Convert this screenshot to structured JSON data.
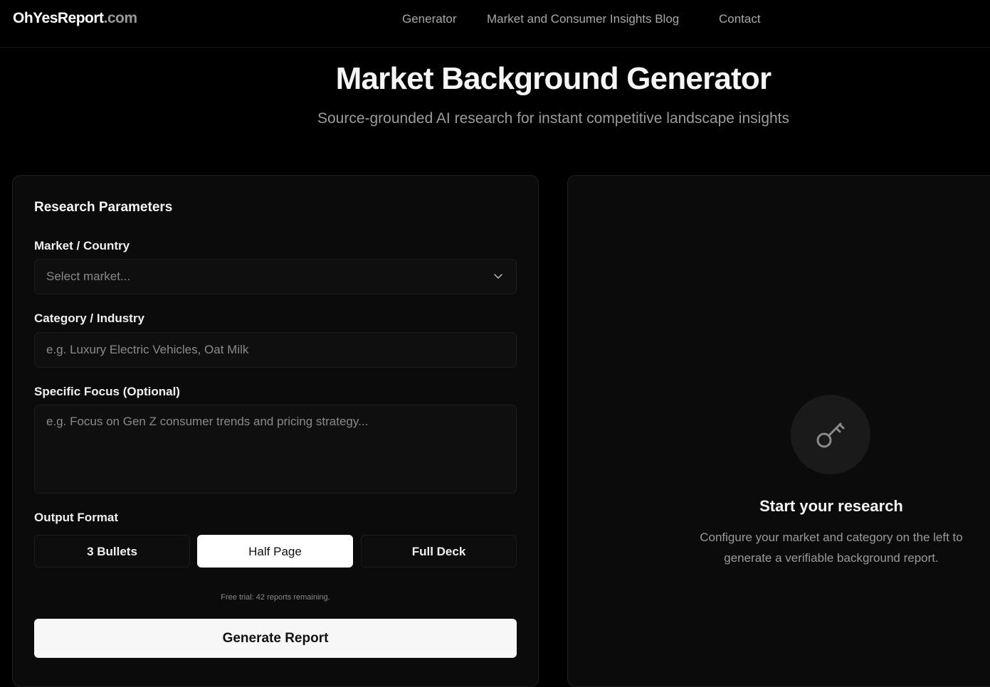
{
  "header": {
    "logo_brand": "OhYesReport",
    "logo_tld": ".com",
    "nav": [
      "Generator",
      "Market and Consumer Insights Blog",
      "Contact"
    ]
  },
  "hero": {
    "title": "Market Background Generator",
    "subtitle": "Source-grounded AI research for instant competitive landscape insights"
  },
  "form": {
    "section_title": "Research Parameters",
    "market_label": "Market / Country",
    "market_placeholder": "Select market...",
    "category_label": "Category / Industry",
    "category_placeholder": "e.g. Luxury Electric Vehicles, Oat Milk",
    "focus_label": "Specific Focus (Optional)",
    "focus_placeholder": "e.g. Focus on Gen Z consumer trends and pricing strategy...",
    "output_label": "Output Format",
    "formats": [
      "3 Bullets",
      "Half Page",
      "Full Deck"
    ],
    "selected_format": "Half Page",
    "trial_text": "Free trial: 42 reports remaining.",
    "generate_label": "Generate Report"
  },
  "empty_state": {
    "icon": "key-icon",
    "title": "Start your research",
    "desc_line1": "Configure your market and category on the left to",
    "desc_line2": "generate a verifiable background report."
  },
  "colors": {
    "background": "#000000",
    "panel": "#0b0b0b",
    "active_button": "#ffffff"
  }
}
